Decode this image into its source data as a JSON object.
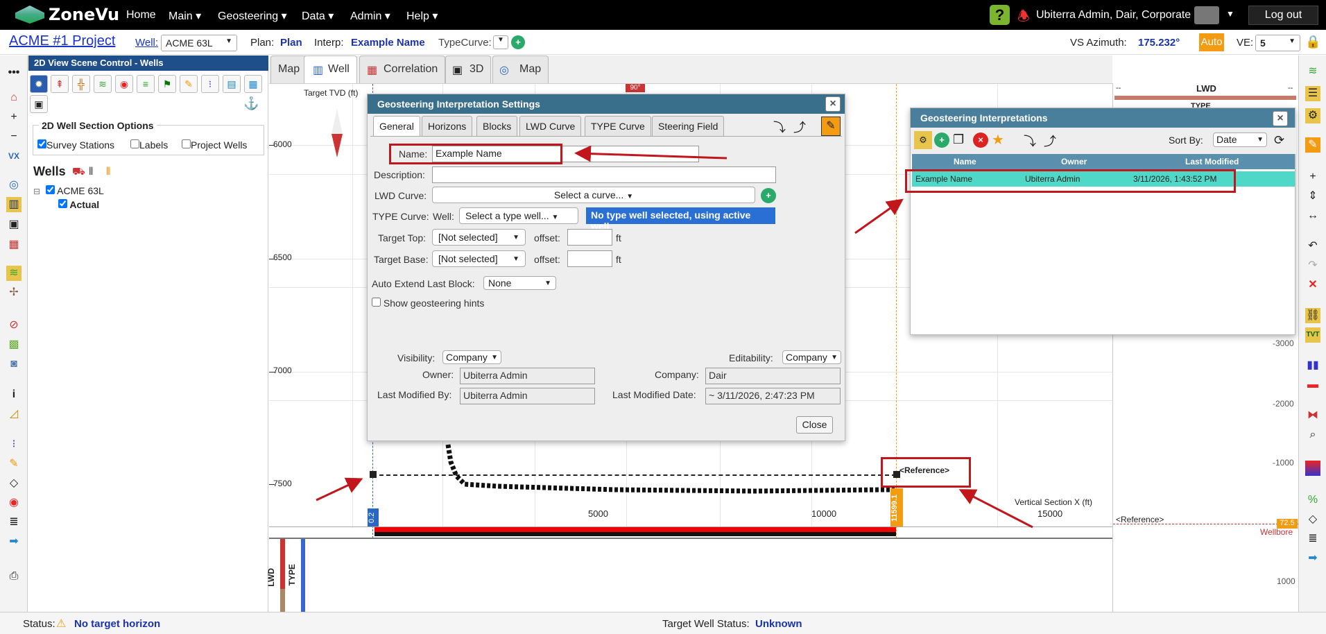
{
  "app": {
    "logo_text": "ZoneVu"
  },
  "nav": {
    "home": "Home",
    "main": "Main ▾",
    "geosteering": "Geosteering ▾",
    "data": "Data ▾",
    "admin": "Admin ▾",
    "help": "Help ▾"
  },
  "user": {
    "label": "Ubiterra Admin, Dair, Corporate",
    "logout": "Log out",
    "help_glyph": "?"
  },
  "project": {
    "title": "ACME #1 Project",
    "well_label": "Well:",
    "well_value": "ACME 63L",
    "plan_label": "Plan:",
    "plan_value": "Plan",
    "interp_label": "Interp:",
    "interp_value": "Example Name",
    "typecurve_label": "TypeCurve:",
    "vs_azimuth_label": "VS Azimuth:",
    "vs_azimuth_value": "175.232°",
    "auto_label": "Auto",
    "ve_label": "VE:",
    "ve_value": "5"
  },
  "panel": {
    "title": "2D View Scene Control - Wells",
    "section_title": "2D Well Section Options",
    "opt_survey": "Survey Stations",
    "opt_labels": "Labels",
    "opt_project_wells": "Project Wells",
    "wells_title": "Wells",
    "tree_well": "ACME 63L",
    "tree_actual": "Actual"
  },
  "tabs": {
    "map1": "Map",
    "well": "Well",
    "correlation": "Correlation",
    "threed": "3D",
    "map2": "Map"
  },
  "plot": {
    "yaxis_title": "Target TVD (ft)",
    "y_ticks": [
      "6000",
      "6500",
      "7000",
      "7500"
    ],
    "x_ticks": [
      "5000",
      "10000",
      "15000"
    ],
    "xaxis_title": "Vertical Section X (ft)",
    "marker_left": "0.2",
    "marker_right": "11599.1",
    "reference_label": "<Reference>",
    "top_badge": "90°"
  },
  "tracks": {
    "lwd": "LWD",
    "type": "TYPE"
  },
  "rightpanel": {
    "lwd_title": "LWD",
    "type_title": "TYPE",
    "dash_left": "--",
    "dash_right": "--",
    "ticks": [
      "-3000",
      "-2000",
      "-1000",
      "1000"
    ],
    "reference": "<Reference>",
    "wellbore": "Wellbore",
    "badge": "72.5"
  },
  "settings_dialog": {
    "title": "Geosteering Interpretation Settings",
    "tabs": [
      "General",
      "Horizons",
      "Blocks",
      "LWD Curve",
      "TYPE Curve",
      "Steering Field"
    ],
    "name_label": "Name:",
    "name_value": "Example Name",
    "description_label": "Description:",
    "description_value": "",
    "lwd_curve_label": "LWD Curve:",
    "lwd_curve_value": "Select a curve...",
    "type_curve_label": "TYPE Curve:",
    "type_well_label": "Well:",
    "type_well_value": "Select a type well...",
    "type_well_notice": "No type well selected, using active well",
    "target_top_label": "Target Top:",
    "target_top_value": "[Not selected]",
    "target_base_label": "Target Base:",
    "target_base_value": "[Not selected]",
    "offset_label": "offset:",
    "offset_unit": "ft",
    "auto_extend_label": "Auto Extend Last Block:",
    "auto_extend_value": "None",
    "hints_label": "Show geosteering hints",
    "visibility_label": "Visibility:",
    "visibility_value": "Company",
    "editability_label": "Editability:",
    "editability_value": "Company",
    "owner_label": "Owner:",
    "owner_value": "Ubiterra Admin",
    "company_label": "Company:",
    "company_value": "Dair",
    "last_modified_by_label": "Last Modified By:",
    "last_modified_by_value": "Ubiterra Admin",
    "last_modified_date_label": "Last Modified Date:",
    "last_modified_date_value": "~ 3/11/2026, 2:47:23 PM",
    "close_button": "Close"
  },
  "interp_dialog": {
    "title": "Geosteering Interpretations",
    "sort_label": "Sort By:",
    "sort_value": "Date",
    "columns": [
      "Name",
      "Owner",
      "Last Modified"
    ],
    "rows": [
      {
        "name": "Example Name",
        "owner": "Ubiterra Admin",
        "modified": "3/11/2026, 1:43:52 PM"
      }
    ]
  },
  "status": {
    "label": "Status:",
    "value": "No target horizon",
    "target_label": "Target Well Status:",
    "target_value": "Unknown"
  },
  "colors": {
    "accent_blue": "#1a33cc",
    "dialog_header": "#3a6f8c",
    "highlight_row": "#4fd8c8",
    "annotation_red": "#c0161c",
    "orange": "#f39c12"
  }
}
